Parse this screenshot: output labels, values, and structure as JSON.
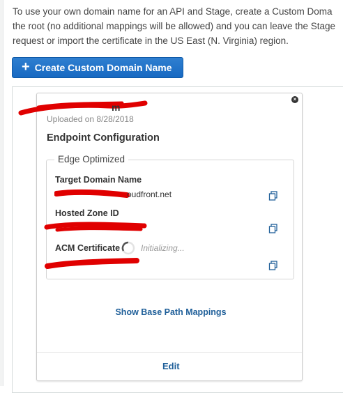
{
  "intro": {
    "line1": "To use your own domain name for an API and Stage, create a Custom Doma",
    "line2": "the root (no additional mappings will be allowed) and you can leave the Stage",
    "line3": "request or import the certificate in the US East (N. Virginia) region."
  },
  "create_button": {
    "icon": "plus-icon",
    "label": "Create Custom Domain Name"
  },
  "card": {
    "domain_name_visible": "m",
    "uploaded": "Uploaded on 8/28/2018",
    "section_title": "Endpoint Configuration",
    "endpoint_type": "Edge Optimized",
    "fields": {
      "target_domain": {
        "label": "Target Domain Name",
        "value_visible": "oudfront.net"
      },
      "hosted_zone": {
        "label": "Hosted Zone ID",
        "value_visible": ""
      },
      "acm_certificate": {
        "label": "ACM Certificate",
        "status": "Initializing..."
      }
    },
    "show_mappings": "Show Base Path Mappings",
    "edit": "Edit"
  },
  "colors": {
    "primary_button": "#1769c2",
    "link": "#1f5f99",
    "redaction": "#e00000"
  }
}
